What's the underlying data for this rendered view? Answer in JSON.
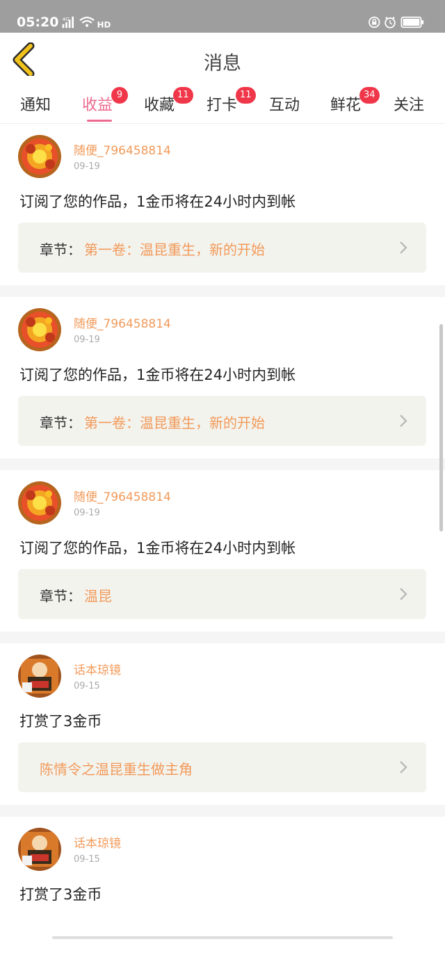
{
  "status": {
    "time": "05:20",
    "network": "4G",
    "hd": "HD"
  },
  "navbar": {
    "title": "消息"
  },
  "tabs": [
    {
      "label": "通知",
      "badge": ""
    },
    {
      "label": "收益",
      "badge": "9",
      "active": true
    },
    {
      "label": "收藏",
      "badge": "11"
    },
    {
      "label": "打卡",
      "badge": "11"
    },
    {
      "label": "互动",
      "badge": ""
    },
    {
      "label": "鲜花",
      "badge": "34"
    },
    {
      "label": "关注",
      "badge": ""
    }
  ],
  "messages": [
    {
      "user": "随便_796458814",
      "date": "09-19",
      "text": "订阅了您的作品，1金币将在24小时内到帐",
      "chapter_prefix": "章节：",
      "chapter": "第一卷：温昆重生，新的开始",
      "avatar": "flower-avatar"
    },
    {
      "user": "随便_796458814",
      "date": "09-19",
      "text": "订阅了您的作品，1金币将在24小时内到帐",
      "chapter_prefix": "章节：",
      "chapter": "第一卷：温昆重生，新的开始",
      "avatar": "flower-avatar"
    },
    {
      "user": "随便_796458814",
      "date": "09-19",
      "text": "订阅了您的作品，1金币将在24小时内到帐",
      "chapter_prefix": "章节：",
      "chapter": "温昆",
      "avatar": "flower-avatar"
    },
    {
      "user": "话本琼镜",
      "date": "09-15",
      "text": "打赏了3金币",
      "chapter_prefix": "",
      "chapter": "陈情令之温昆重生做主角",
      "avatar": "book-avatar"
    },
    {
      "user": "话本琼镜",
      "date": "09-15",
      "text": "打赏了3金币",
      "chapter_prefix": "",
      "chapter": "",
      "avatar": "book-avatar"
    }
  ],
  "colors": {
    "accent": "#ee6a8f",
    "badge": "#f0374a",
    "name": "#f29a5a",
    "back": "#f2c21c"
  }
}
